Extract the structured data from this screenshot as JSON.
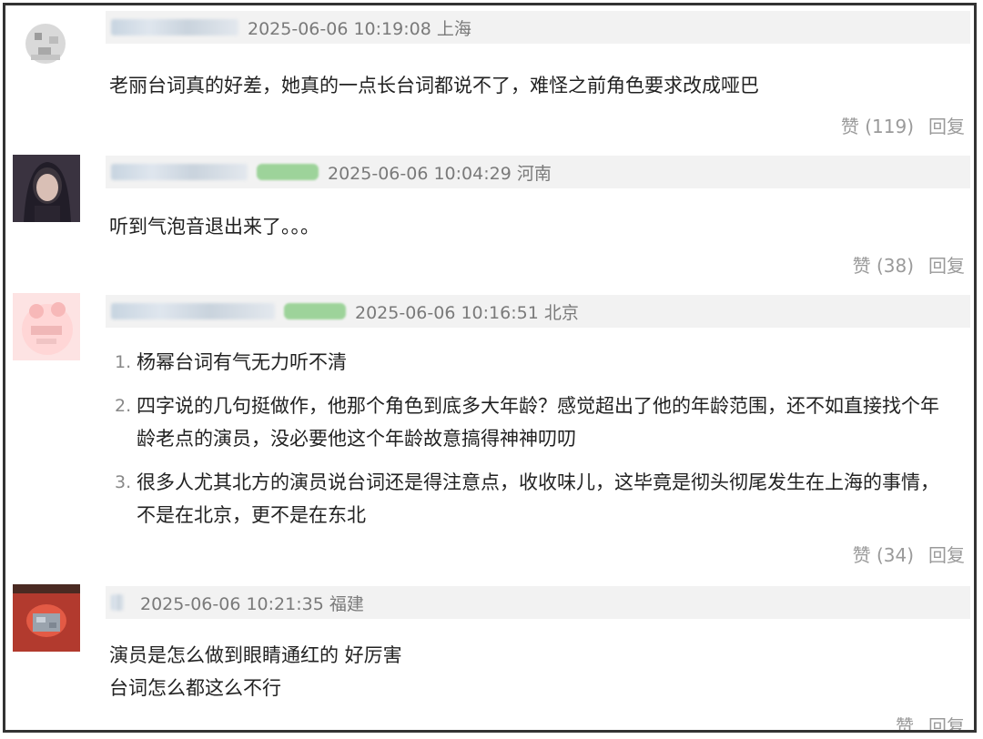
{
  "comments": [
    {
      "timestamp": "2025-06-06 10:19:08",
      "location": "上海",
      "text": "老丽台词真的好差，她真的一点长台词都说不了，难怪之前角色要求改成哑巴",
      "like_label": "赞",
      "like_count": "(119)",
      "reply_label": "回复"
    },
    {
      "timestamp": "2025-06-06 10:04:29",
      "location": "河南",
      "text": "听到气泡音退出来了。。。",
      "like_label": "赞",
      "like_count": "(38)",
      "reply_label": "回复"
    },
    {
      "timestamp": "2025-06-06 10:16:51",
      "location": "北京",
      "items": [
        {
          "num": "1.",
          "text": "杨幂台词有气无力听不清"
        },
        {
          "num": "2.",
          "text": "四字说的几句挺做作，他那个角色到底多大年龄？感觉超出了他的年龄范围，还不如直接找个年龄老点的演员，没必要他这个年龄故意搞得神神叨叨"
        },
        {
          "num": "3.",
          "text": "很多人尤其北方的演员说台词还是得注意点，收收味儿，这毕竟是彻头彻尾发生在上海的事情，不是在北京，更不是在东北"
        }
      ],
      "like_label": "赞",
      "like_count": "(34)",
      "reply_label": "回复"
    },
    {
      "timestamp": "2025-06-06 10:21:35",
      "location": "福建",
      "line1": "演员是怎么做到眼睛通红的 好厉害",
      "line2": "台词怎么都这么不行",
      "like_label": "赞",
      "reply_label": "回复"
    }
  ]
}
